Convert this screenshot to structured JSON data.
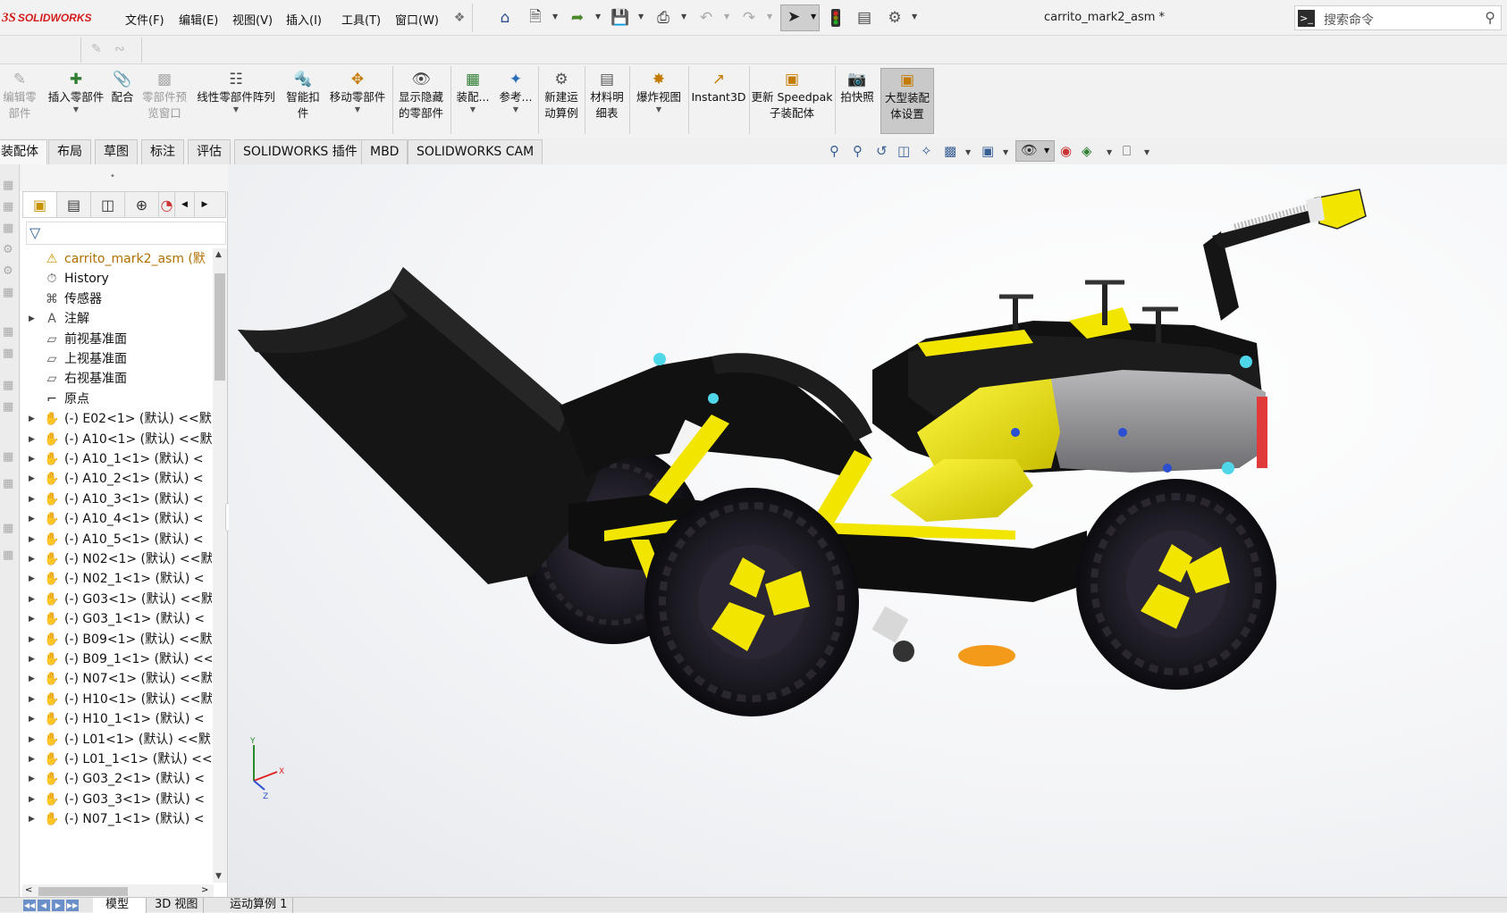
{
  "app": {
    "logo_prefix": "3S",
    "logo_name": "SOLIDWORKS",
    "window_title": "carrito_mark2_asm *"
  },
  "menu": [
    "文件(F)",
    "编辑(E)",
    "视图(V)",
    "插入(I)",
    "工具(T)",
    "窗口(W)"
  ],
  "search": {
    "placeholder": "搜索命令"
  },
  "ribbon": [
    {
      "label_1": "编辑零",
      "label_2": "部件",
      "icon": "edit-component-icon",
      "disabled": true
    },
    {
      "label_1": "插入零部件",
      "label_2": "",
      "icon": "insert-component-icon",
      "disabled": false
    },
    {
      "label_1": "配合",
      "label_2": "",
      "icon": "mate-icon",
      "disabled": false
    },
    {
      "label_1": "零部件预",
      "label_2": "览窗口",
      "icon": "preview-window-icon",
      "disabled": true
    },
    {
      "label_1": "线性零部件阵列",
      "label_2": "",
      "icon": "linear-pattern-icon",
      "disabled": false
    },
    {
      "label_1": "智能扣",
      "label_2": "件",
      "icon": "smart-fastener-icon",
      "disabled": false
    },
    {
      "label_1": "移动零部件",
      "label_2": "",
      "icon": "move-component-icon",
      "disabled": false
    },
    {
      "label_1": "显示隐藏",
      "label_2": "的零部件",
      "icon": "show-hidden-icon",
      "disabled": false
    },
    {
      "label_1": "装配...",
      "label_2": "",
      "icon": "assembly-features-icon",
      "disabled": false
    },
    {
      "label_1": "参考...",
      "label_2": "",
      "icon": "reference-geometry-icon",
      "disabled": false
    },
    {
      "label_1": "新建运",
      "label_2": "动算例",
      "icon": "new-motion-study-icon",
      "disabled": false
    },
    {
      "label_1": "材料明",
      "label_2": "细表",
      "icon": "bom-icon",
      "disabled": false
    },
    {
      "label_1": "爆炸视图",
      "label_2": "",
      "icon": "exploded-view-icon",
      "disabled": false
    },
    {
      "label_1": "Instant3D",
      "label_2": "",
      "icon": "instant3d-icon",
      "disabled": false
    },
    {
      "label_1": "更新 Speedpak",
      "label_2": "子装配体",
      "icon": "speedpak-icon",
      "disabled": false
    },
    {
      "label_1": "拍快照",
      "label_2": "",
      "icon": "snapshot-icon",
      "disabled": false
    },
    {
      "label_1": "大型装配",
      "label_2": "体设置",
      "icon": "large-assembly-icon",
      "disabled": false
    }
  ],
  "tabs": [
    "装配体",
    "布局",
    "草图",
    "标注",
    "评估",
    "SOLIDWORKS 插件",
    "MBD",
    "SOLIDWORKS CAM"
  ],
  "tree": {
    "root": "carrito_mark2_asm (默",
    "fixed_nodes": [
      "History",
      "传感器",
      "注解",
      "前视基准面",
      "上视基准面",
      "右视基准面",
      "原点"
    ],
    "components": [
      "(-) E02<1> (默认) <<默",
      "(-) A10<1> (默认) <<默",
      "(-) A10_1<1> (默认) <",
      "(-) A10_2<1> (默认) <",
      "(-) A10_3<1> (默认) <",
      "(-) A10_4<1> (默认) <",
      "(-) A10_5<1> (默认) <",
      "(-) N02<1> (默认) <<默",
      "(-) N02_1<1> (默认) <",
      "(-) G03<1> (默认) <<默",
      "(-) G03_1<1> (默认) <",
      "(-) B09<1> (默认) <<默",
      "(-) B09_1<1> (默认) <<",
      "(-) N07<1> (默认) <<默",
      "(-) H10<1> (默认) <<默",
      "(-) H10_1<1> (默认) <",
      "(-) L01<1> (默认) <<默",
      "(-) L01_1<1> (默认) <<",
      "(-) G03_2<1> (默认) <",
      "(-) G03_3<1> (默认) <",
      "(-) N07_1<1> (默认) <"
    ]
  },
  "bottom_tabs": [
    "模型",
    "3D 视图",
    "运动算例 1"
  ],
  "triad": {
    "x": "X",
    "y": "Y",
    "z": "Z"
  },
  "colors": {
    "brand_red": "#d41c1c",
    "lego_yellow": "#f2e600",
    "lego_black": "#141414",
    "lego_gray": "#8a8a8c",
    "accent_blue": "#2a4f8a"
  }
}
